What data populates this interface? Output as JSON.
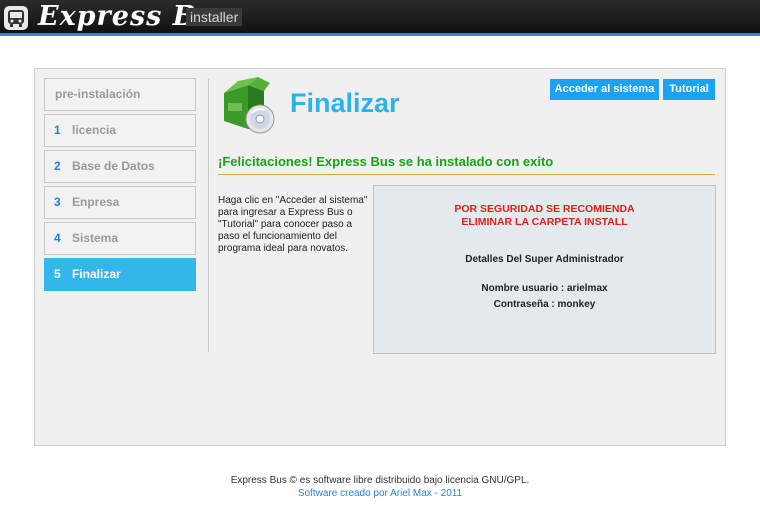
{
  "header": {
    "brand": "Express Bus",
    "subtitle": "installer"
  },
  "steps": [
    {
      "num": "",
      "label": "pre-instalación"
    },
    {
      "num": "1",
      "label": "licencia"
    },
    {
      "num": "2",
      "label": "Base de Datos"
    },
    {
      "num": "3",
      "label": "Enpresa"
    },
    {
      "num": "4",
      "label": "Sistema"
    },
    {
      "num": "5",
      "label": "Finalizar"
    }
  ],
  "main": {
    "title": "Finalizar",
    "buttons": {
      "access_label": "Acceder al sistema",
      "tutorial_label": "Tutorial"
    },
    "congrats": "¡Felicitaciones! Express Bus se ha instalado con exito",
    "description": "Haga clic en \"Acceder al sistema\" para ingresar a Express Bus o \"Tutorial\" para conocer paso a paso el funcionamiento del programa ideal para novatos.",
    "info": {
      "warning_line1": "POR SEGURIDAD SE RECOMIENDA",
      "warning_line2": "ELIMINAR LA CARPETA INSTALL",
      "admin_title": "Detalles Del Super Administrador",
      "username": "Nombre usuario : arielmax",
      "password": "Contraseña : monkey"
    }
  },
  "footer": {
    "license": "Express Bus © es software libre distribuido bajo licencia GNU/GPL.",
    "credit": "Software creado por Ariel Max - 2011"
  },
  "colors": {
    "accent": "#2ab4ea",
    "button": "#1da1f2",
    "success": "#1aa21a",
    "warning": "#e0201c"
  },
  "icons": {
    "header": "bus-icon",
    "title": "software-box-cd-icon"
  }
}
